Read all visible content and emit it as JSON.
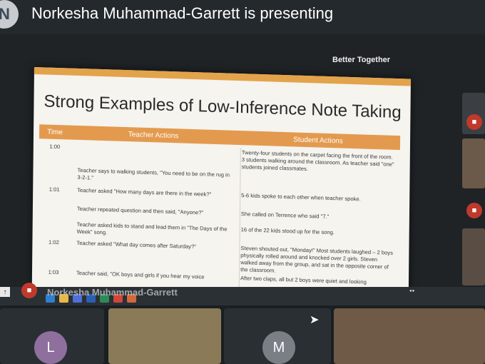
{
  "header": {
    "avatar_letter": "N",
    "presenting_text": "Norkesha Muhammad-Garrett is presenting"
  },
  "slide": {
    "brand": "Better Together",
    "title": "Strong Examples of Low-Inference Note Taking",
    "columns": [
      "Time",
      "Teacher Actions",
      "Student Actions"
    ],
    "rows": [
      {
        "time": "1:00",
        "teacher": "",
        "student": "Twenty-four students on the carpet facing the front of the room. 3 students walking around the classroom. As teacher said \"one\" students joined classmates."
      },
      {
        "time": "",
        "teacher": "Teacher says to walking students, \"You need to be on the rug in 3-2-1.\"",
        "student": ""
      },
      {
        "time": "1:01",
        "teacher": "Teacher asked \"How many days are there in the week?\"",
        "student": "5-6 kids spoke to each other when teacher spoke."
      },
      {
        "time": "",
        "teacher": "Teacher repeated question and then said, \"Anyone?\"",
        "student": "She called on Terrence who said \"7.\""
      },
      {
        "time": "",
        "teacher": "Teacher asked kids to stand and lead them in \"The Days of the Week\" song.",
        "student": "16 of the 22 kids stood up for the song."
      },
      {
        "time": "1:02",
        "teacher": "Teacher asked \"What day comes after Saturday?\"",
        "student": "Steven shouted out, \"Monday!\" Most students laughed – 2 boys physically rolled around and knocked over 2 girls. Steven walked away from the group, and sat in the opposite corner of the classroom."
      },
      {
        "time": "1:03",
        "teacher": "Teacher said, \"OK boys and girls if you hear my voice",
        "student": "After two claps, all but 2 boys were quiet and looking"
      }
    ]
  },
  "presenter_overlay": {
    "name": "Norkesha Muhammad-Garrett"
  },
  "participants": [
    {
      "letter": "L",
      "color": "#8e6f9e"
    },
    {
      "letter": "M",
      "color": "#7a7f86"
    }
  ],
  "colors": {
    "accent_orange": "#e39a4e",
    "mute_red": "#c0392b"
  }
}
